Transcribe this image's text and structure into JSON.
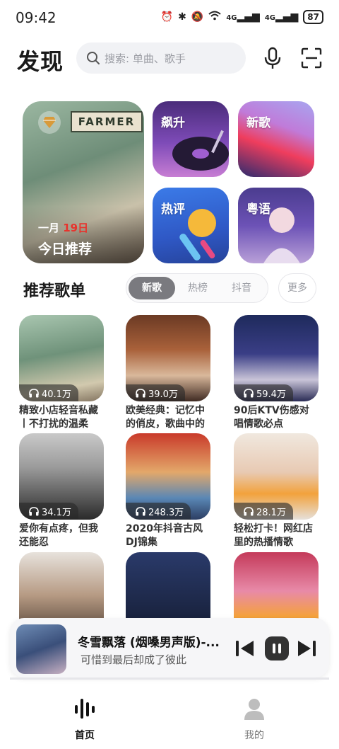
{
  "status_bar": {
    "time": "09:42",
    "battery": "87",
    "net1": "4G",
    "net2": "4G"
  },
  "header": {
    "title": "发现",
    "search_placeholder": "搜索: 单曲、歌手",
    "icons": [
      "mic-icon",
      "scan-icon",
      "search-icon"
    ]
  },
  "featured": {
    "month": "一月",
    "day": "19日",
    "title": "今日推荐",
    "sign_text": "FARMER"
  },
  "tiles": [
    {
      "label": "飙升"
    },
    {
      "label": "新歌"
    },
    {
      "label": "热评"
    },
    {
      "label": "粤语"
    }
  ],
  "section": {
    "title": "推荐歌单",
    "tabs": [
      "新歌",
      "热榜",
      "抖音"
    ],
    "active_tab": "新歌",
    "more": "更多"
  },
  "playlists": [
    {
      "plays": "40.1万",
      "name": "精致小店轻音私藏丨不打扰的温柔"
    },
    {
      "plays": "39.0万",
      "name": "欧美经典：记忆中的俏皮，歌曲中的"
    },
    {
      "plays": "59.4万",
      "name": "90后KTV伤感对唱情歌必点"
    },
    {
      "plays": "34.1万",
      "name": "爱你有点疼，但我还能忍"
    },
    {
      "plays": "248.3万",
      "name": "2020年抖音古风DJ锦集"
    },
    {
      "plays": "28.1万",
      "name": "轻松打卡！网红店里的热播情歌"
    }
  ],
  "player": {
    "title": "冬雪飘落 (烟嗓男声版)-...",
    "lyric": "可惜到最后却成了彼此"
  },
  "nav": {
    "home": "首页",
    "me": "我的"
  },
  "colors": {
    "accent_red": "#e8322c",
    "active_tab": "#7a7a7f"
  }
}
